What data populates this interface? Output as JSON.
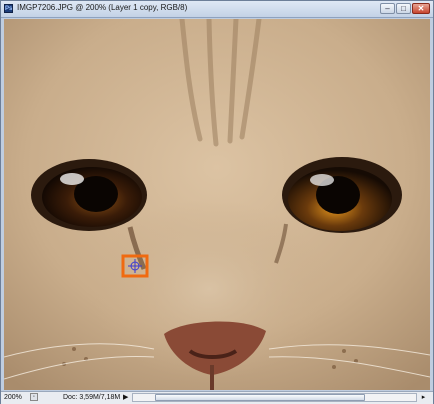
{
  "window": {
    "title": "IMGP7206.JPG @ 200% (Layer 1 copy, RGB/8)",
    "app_icon_text": "Ps",
    "buttons": {
      "minimize": "–",
      "maximize": "□",
      "close": "✕"
    }
  },
  "status": {
    "zoom": "200%",
    "doc_info": "Doc: 3,59M/7,18M",
    "arrow": "▶",
    "scroll_right": "▸"
  },
  "colors": {
    "fur": "#c9ad8b",
    "selection_box": "#f06a10",
    "iris_left": "#6b3b12",
    "iris_right": "#a86412"
  },
  "icons": [
    "photoshop-app-icon",
    "crosshair-icon"
  ]
}
